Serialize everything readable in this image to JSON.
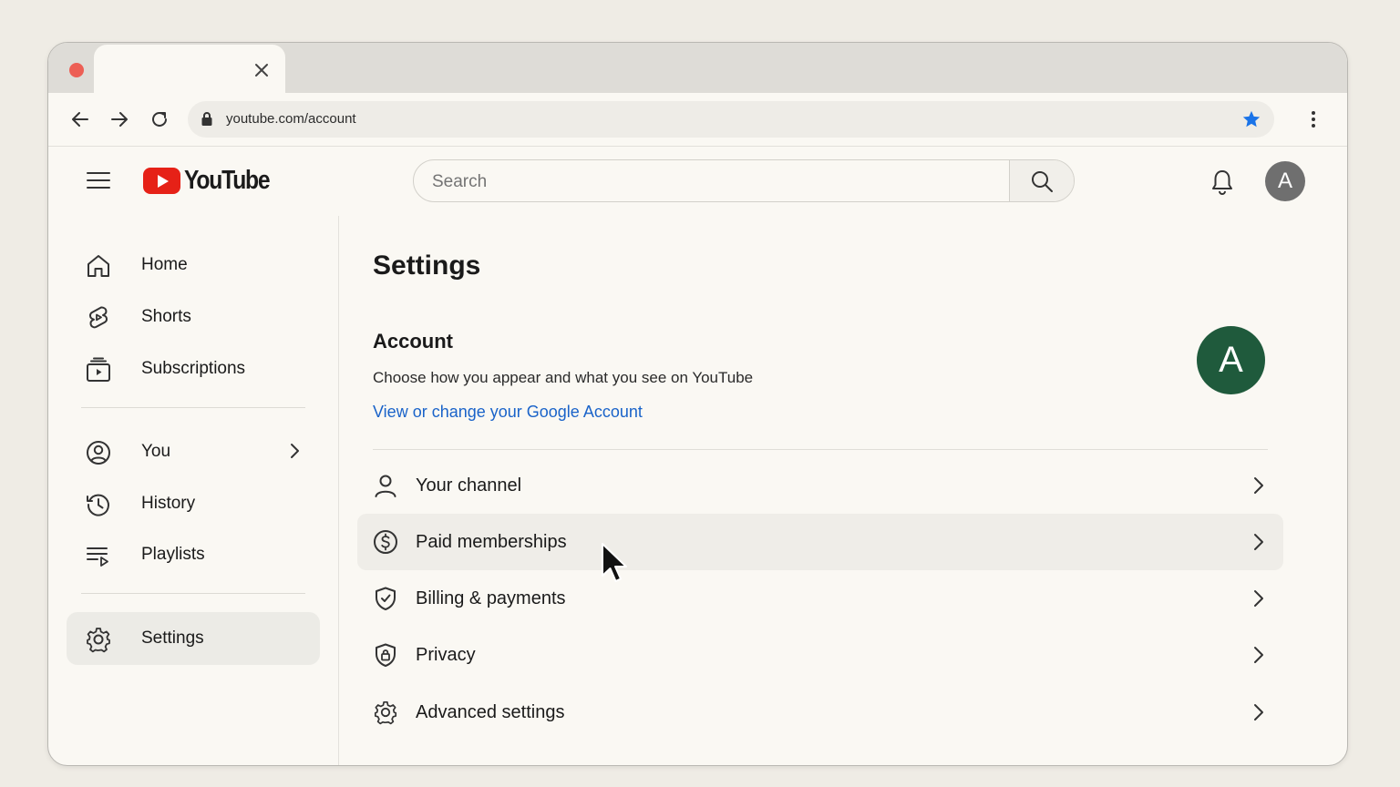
{
  "browser": {
    "url": "youtube.com/account",
    "traffic_colors": {
      "close": "#ed5f55",
      "minimize": "#f6be3b",
      "maximize": "#3fc24e"
    },
    "star_color": "#1a73e8"
  },
  "header": {
    "logo_text": "YouTube",
    "search_placeholder": "Search",
    "avatar_letter": "A"
  },
  "sidebar": {
    "items": [
      {
        "label": "Home",
        "icon": "home-icon"
      },
      {
        "label": "Shorts",
        "icon": "shorts-icon"
      },
      {
        "label": "Subscriptions",
        "icon": "subscriptions-icon"
      },
      {
        "label": "You",
        "icon": "you-icon"
      },
      {
        "label": "History",
        "icon": "history-icon"
      },
      {
        "label": "Playlists",
        "icon": "playlists-icon"
      },
      {
        "label": "Settings",
        "icon": "settings-icon",
        "active": true
      }
    ]
  },
  "main": {
    "title": "Settings",
    "account": {
      "heading": "Account",
      "description": "Choose how you appear and what you see on YouTube",
      "link": "View or change your Google Account",
      "avatar_letter": "A",
      "avatar_color": "#1f5a3c"
    },
    "rows": [
      {
        "label": "Your channel",
        "icon": "person-icon"
      },
      {
        "label": "Paid memberships",
        "icon": "dollar-icon",
        "hovered": true
      },
      {
        "label": "Billing & payments",
        "icon": "shield-check-icon"
      },
      {
        "label": "Privacy",
        "icon": "shield-lock-icon"
      },
      {
        "label": "Advanced settings",
        "icon": "gear-icon"
      }
    ]
  }
}
